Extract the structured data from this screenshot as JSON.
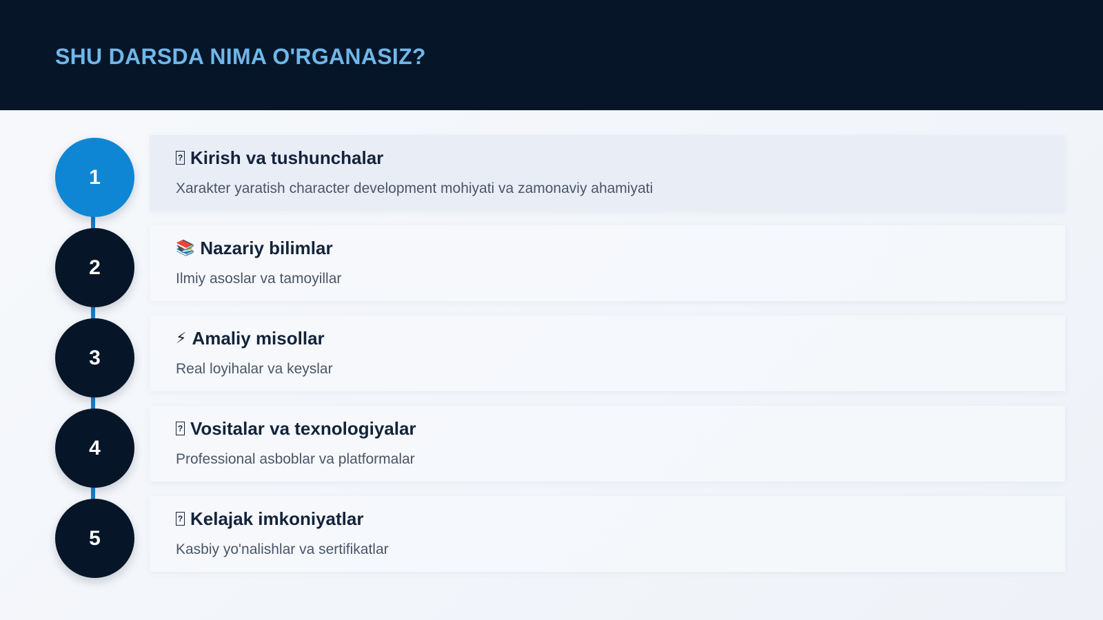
{
  "header": {
    "title": "SHU DARSDA NIMA O'RGANASIZ?"
  },
  "steps": [
    {
      "number": "1",
      "icon": "question-box-icon",
      "icon_glyph": "?",
      "title": "Kirish va tushunchalar",
      "description": "Xarakter yaratish character development mohiyati va zamonaviy ahamiyati",
      "active": true
    },
    {
      "number": "2",
      "icon": "books-icon",
      "icon_glyph": "📚",
      "title": "Nazariy bilimlar",
      "description": "Ilmiy asoslar va tamoyillar",
      "active": false
    },
    {
      "number": "3",
      "icon": "lightning-icon",
      "icon_glyph": "⚡",
      "title": "Amaliy misollar",
      "description": "Real loyihalar va keyslar",
      "active": false
    },
    {
      "number": "4",
      "icon": "question-box-icon",
      "icon_glyph": "?",
      "title": "Vositalar va texnologiyalar",
      "description": "Professional asboblar va platformalar",
      "active": false
    },
    {
      "number": "5",
      "icon": "question-box-icon",
      "icon_glyph": "?",
      "title": "Kelajak imkoniyatlar",
      "description": "Kasbiy yo'nalishlar va sertifikatlar",
      "active": false
    }
  ],
  "colors": {
    "header_bg": "#061628",
    "title": "#6fb7ea",
    "active_circle": "#0e86d4",
    "circle": "#061628",
    "timeline": "#1a7fc9"
  }
}
